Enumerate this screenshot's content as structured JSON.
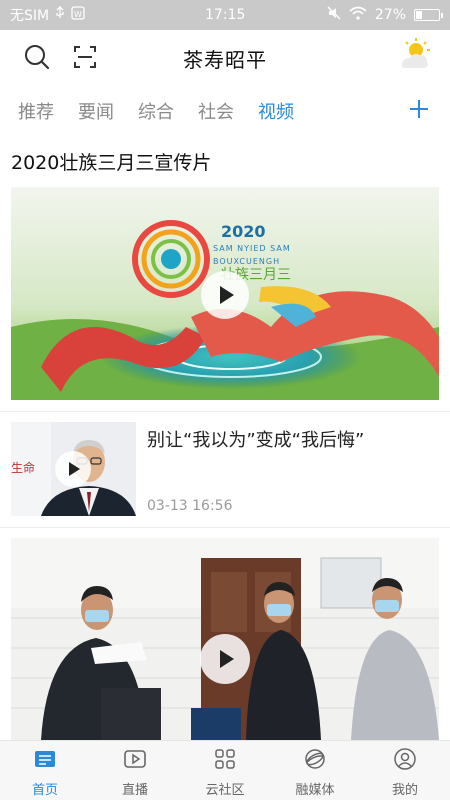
{
  "status_bar": {
    "carrier": "无SIM",
    "time": "17:15",
    "battery": "27%"
  },
  "header": {
    "title": "茶寿昭平"
  },
  "tabs": [
    {
      "label": "推荐"
    },
    {
      "label": "要闻"
    },
    {
      "label": "综合"
    },
    {
      "label": "社会"
    },
    {
      "label": "视频",
      "active": true
    }
  ],
  "feed": {
    "featured": {
      "title": "2020壮族三月三宣传片",
      "thumb_text": {
        "year": "2020",
        "line1": "SAM NYIED SAM",
        "line2": "BOUXCUENGH",
        "line3": "壮族三月三"
      }
    },
    "row": {
      "title": "别让“我以为”变成“我后悔”",
      "time": "03-13 16:56"
    }
  },
  "bottom_nav": [
    {
      "label": "首页",
      "icon": "news-icon",
      "active": true
    },
    {
      "label": "直播",
      "icon": "play-icon"
    },
    {
      "label": "云社区",
      "icon": "grid-icon"
    },
    {
      "label": "融媒体",
      "icon": "globe-icon"
    },
    {
      "label": "我的",
      "icon": "user-icon"
    }
  ],
  "colors": {
    "accent": "#2a8ad9",
    "status_bar": "#c9c9c9"
  }
}
